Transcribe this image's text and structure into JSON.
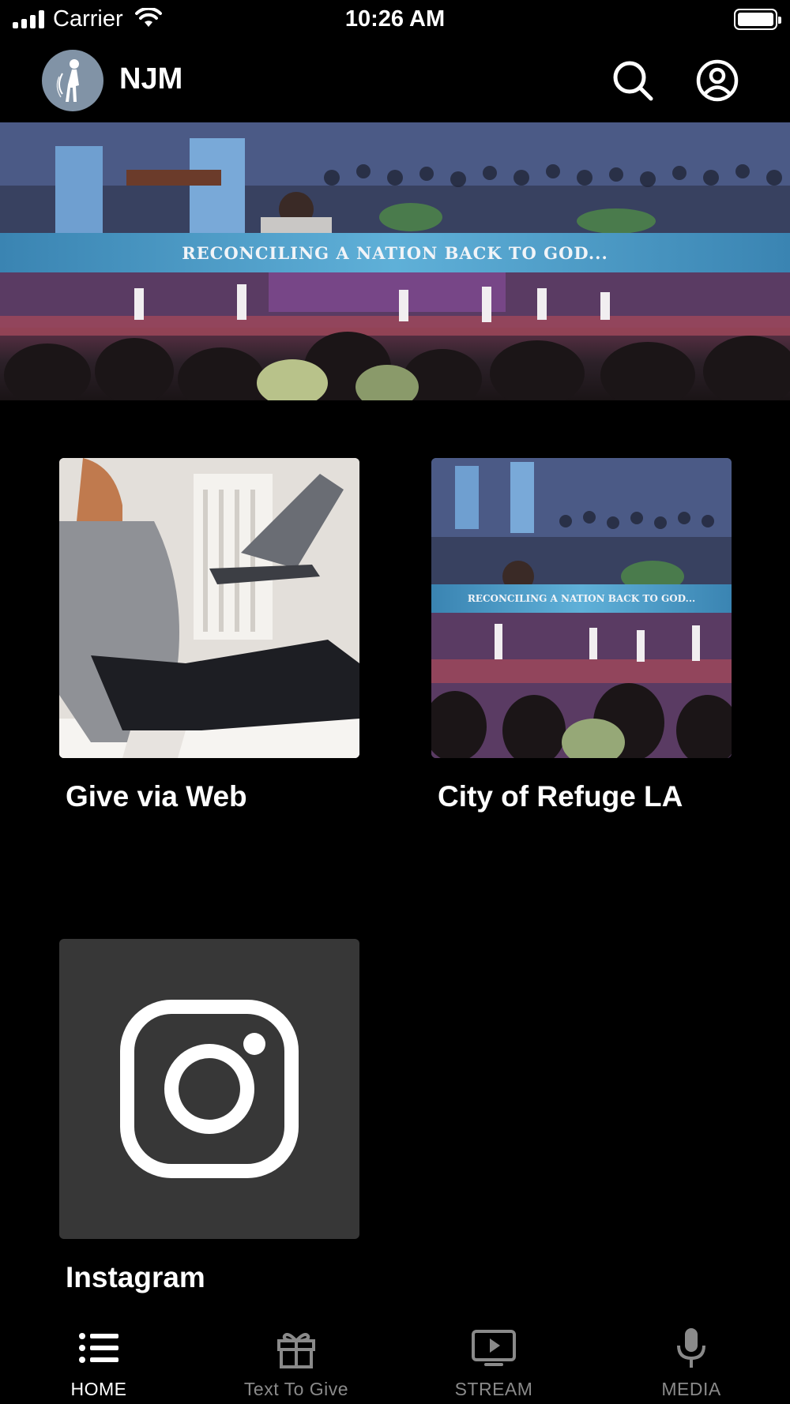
{
  "status_bar": {
    "carrier": "Carrier",
    "time": "10:26 AM"
  },
  "header": {
    "title": "NJM",
    "logo_icon": "njm-logo",
    "search_icon": "search-icon",
    "account_icon": "account-circle-icon"
  },
  "banner": {
    "caption": "RECONCILING A NATION BACK TO GOD..."
  },
  "tiles": [
    {
      "label": "Give via Web"
    },
    {
      "label": "City of Refuge LA",
      "caption": "RECONCILING A NATION BACK TO GOD..."
    },
    {
      "label": "Instagram",
      "icon": "instagram-icon"
    }
  ],
  "tab_bar": {
    "active": "HOME",
    "tabs": [
      {
        "label": "HOME",
        "icon": "list-icon"
      },
      {
        "label": "Text To Give",
        "icon": "gift-icon"
      },
      {
        "label": "STREAM",
        "icon": "tv-play-icon"
      },
      {
        "label": "MEDIA",
        "icon": "microphone-icon"
      }
    ]
  },
  "colors": {
    "background": "#000000",
    "active_tab": "#ffffff",
    "inactive_tab": "#8a8a8a",
    "instagram_tile": "#373737"
  }
}
